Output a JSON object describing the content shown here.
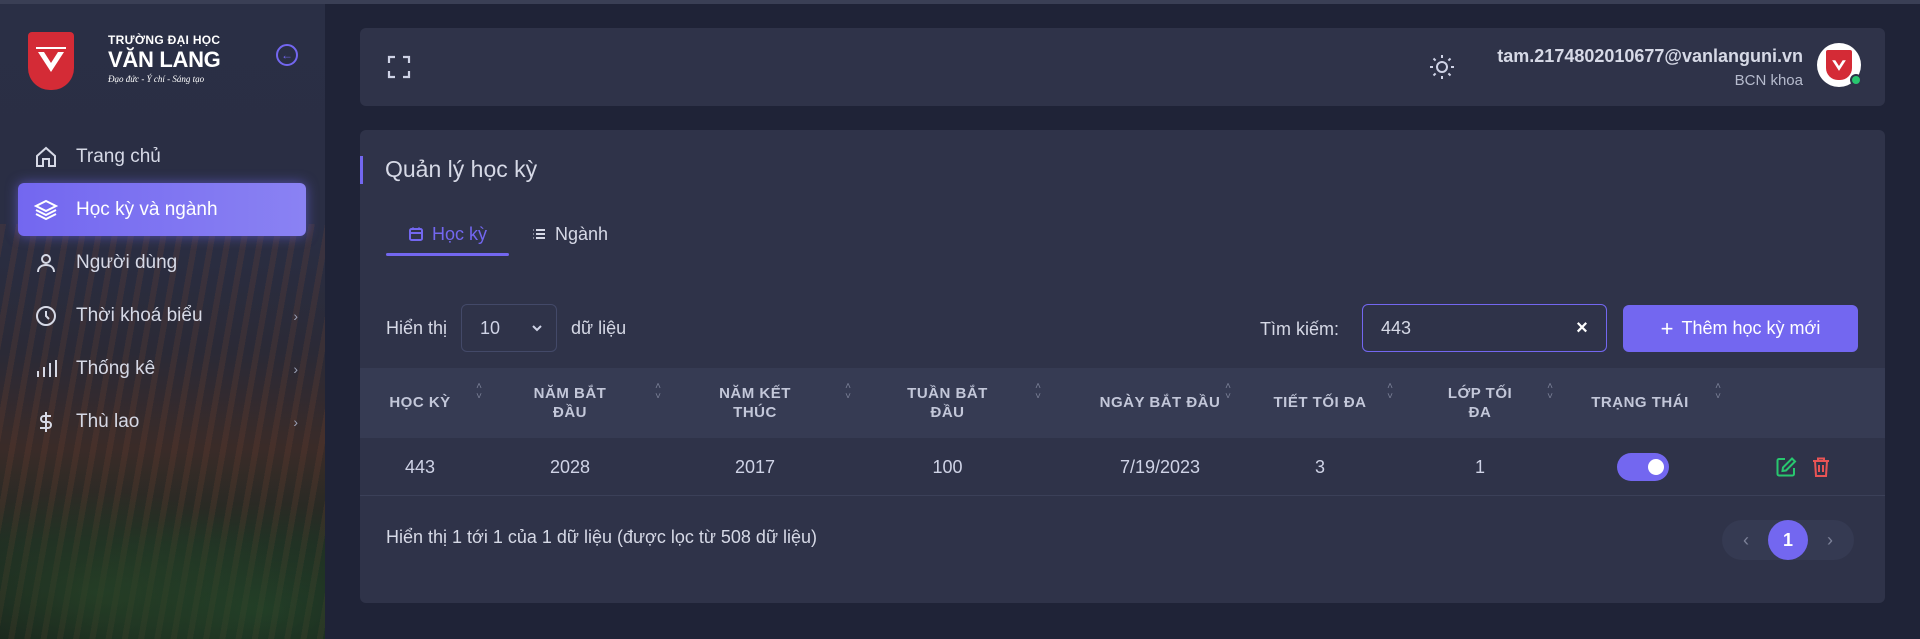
{
  "logo": {
    "line1": "TRƯỜNG ĐẠI HỌC",
    "line2": "VĂN LANG",
    "tagline": "Đạo đức - Ý chí - Sáng tạo"
  },
  "sidebar": {
    "items": [
      {
        "label": "Trang chủ",
        "icon": "home-icon",
        "active": false,
        "has_submenu": false
      },
      {
        "label": "Học kỳ và ngành",
        "icon": "layers-icon",
        "active": true,
        "has_submenu": false
      },
      {
        "label": "Người dùng",
        "icon": "user-icon",
        "active": false,
        "has_submenu": false
      },
      {
        "label": "Thời khoá biểu",
        "icon": "clock-icon",
        "active": false,
        "has_submenu": true
      },
      {
        "label": "Thống kê",
        "icon": "bar-chart-icon",
        "active": false,
        "has_submenu": true
      },
      {
        "label": "Thù lao",
        "icon": "dollar-icon",
        "active": false,
        "has_submenu": true
      }
    ]
  },
  "header": {
    "email": "tam.2174802010677@vanlanguni.vn",
    "role": "BCN khoa"
  },
  "page": {
    "title": "Quản lý học kỳ",
    "tabs": [
      {
        "label": "Học kỳ",
        "active": true
      },
      {
        "label": "Ngành",
        "active": false
      }
    ]
  },
  "controls": {
    "show_label": "Hiển thị",
    "page_size": "10",
    "records_label": "dữ liệu",
    "search_label": "Tìm kiếm:",
    "search_value": "443",
    "add_button": "Thêm học kỳ mới"
  },
  "table": {
    "columns": [
      "HỌC KỲ",
      "NĂM BẮT ĐẦU",
      "NĂM KẾT THÚC",
      "TUẦN BẮT ĐẦU",
      "NGÀY BẮT ĐẦU",
      "TIẾT TỐI ĐA",
      "LỚP TỐI ĐA",
      "TRẠNG THÁI"
    ],
    "rows": [
      {
        "hoc_ky": "443",
        "nam_bat_dau": "2028",
        "nam_ket_thuc": "2017",
        "tuan_bat_dau": "100",
        "ngay_bat_dau": "7/19/2023",
        "tiet_toi_da": "3",
        "lop_toi_da": "1",
        "trang_thai": true
      }
    ]
  },
  "footer": {
    "info": "Hiển thị 1 tới 1 của 1 dữ liệu (được lọc từ 508 dữ liệu)",
    "current_page": "1"
  },
  "colors": {
    "accent": "#7367f0",
    "card_bg": "#2f3349",
    "page_bg": "#1f2337",
    "edit": "#28c76f",
    "delete": "#ea5455"
  }
}
